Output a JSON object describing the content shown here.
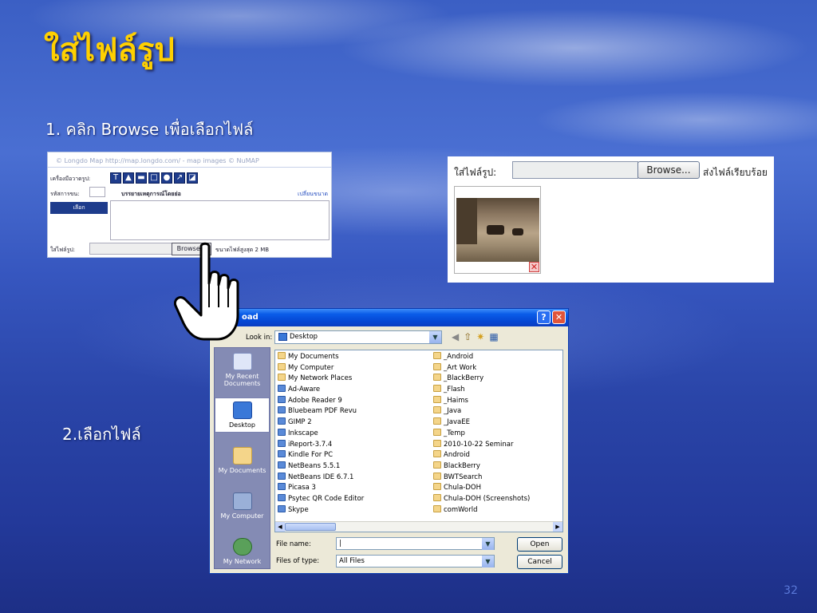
{
  "slide": {
    "title": "ใส่ไฟล์รูป",
    "step1": "1. คลิก Browse เพื่อเลือกไฟล์",
    "step2": "2.เลือกไฟล์",
    "page_number": "32"
  },
  "form": {
    "copyright": "© Longdo Map http://map.longdo.com/ - map images © NuMAP",
    "tools_label": "เครื่องมือวาดรูป:",
    "code_label": "รหัสการขน:",
    "description_label": "บรรยายเหตุการณ์โดยย่อ",
    "resize_link": "เปลี่ยนขนาด",
    "select_button": "เลือก",
    "image_label": "ใส่ไฟล์รูป:",
    "browse_label": "Browse...",
    "max_size": "ขนาดไฟล์สูงสุด 2 MB"
  },
  "result": {
    "image_label": "ใส่ไฟล์รูป:",
    "browse_label": "Browse...",
    "status": "ส่งไฟล์เรียบร้อย"
  },
  "dialog": {
    "title": "oad",
    "look_in_label": "Look in:",
    "look_in_value": "Desktop",
    "places": [
      "My Recent Documents",
      "Desktop",
      "My Documents",
      "My Computer",
      "My Network"
    ],
    "files_left": [
      "My Documents",
      "My Computer",
      "My Network Places",
      "Ad-Aware",
      "Adobe Reader 9",
      "Bluebeam PDF Revu",
      "GIMP 2",
      "Inkscape",
      "iReport-3.7.4",
      "Kindle For PC",
      "NetBeans 5.5.1",
      "NetBeans IDE 6.7.1",
      "Picasa 3",
      "Psytec QR Code Editor",
      "Skype"
    ],
    "files_right": [
      "_Android",
      "_Art Work",
      "_BlackBerry",
      "_Flash",
      "_Haims",
      "_Java",
      "_JavaEE",
      "_Temp",
      "2010-10-22 Seminar",
      "Android",
      "BlackBerry",
      "BWTSearch",
      "Chula-DOH",
      "Chula-DOH (Screenshots)",
      "comWorld"
    ],
    "file_name_label": "File name:",
    "file_name_value": "|",
    "file_type_label": "Files of type:",
    "file_type_value": "All Files",
    "open_label": "Open",
    "cancel_label": "Cancel"
  },
  "colors": {
    "title": "#ffd000",
    "titlebar": "#0547d4",
    "places_bar": "#848bb4"
  }
}
